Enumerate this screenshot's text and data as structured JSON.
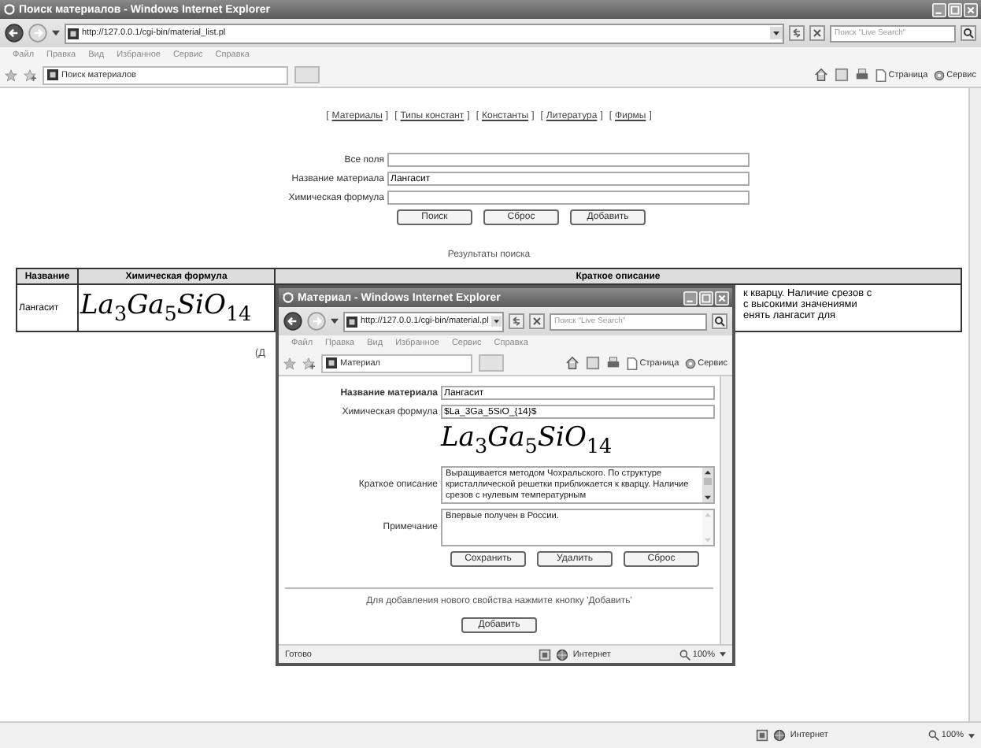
{
  "window": {
    "title": "Поиск материалов - Windows Internet Explorer",
    "url": "http://127.0.0.1/cgi-bin/material_list.pl",
    "search_placeholder": "Поиск \"Live Search\"",
    "menu": [
      "Файл",
      "Правка",
      "Вид",
      "Избранное",
      "Сервис",
      "Справка"
    ],
    "tabs": [
      {
        "label": "Поиск материалов",
        "selected": true
      }
    ],
    "command_bar": {
      "page": "Страница",
      "tools": "Сервис"
    },
    "status_bar": {
      "zone": "Интернет",
      "zoom": "100%"
    }
  },
  "nav_links": [
    {
      "open": "[",
      "label": "Материалы",
      "close": "]"
    },
    {
      "open": "[",
      "label": "Типы констант",
      "close": "]"
    },
    {
      "open": "[",
      "label": "Константы",
      "close": "]"
    },
    {
      "open": "[",
      "label": "Литература",
      "close": "]"
    },
    {
      "open": "[",
      "label": "Фирмы",
      "close": "]"
    }
  ],
  "search_form": {
    "fields": [
      {
        "label": "Все поля"
      },
      {
        "label": "Название материала",
        "value": "Лангасит"
      },
      {
        "label": "Химическая формула"
      }
    ],
    "buttons": [
      "Поиск",
      "Сброс",
      "Добавить"
    ]
  },
  "results_title": "Результаты поиска",
  "table": {
    "columns": [
      "Название",
      "Химическая формула",
      "Краткое описание"
    ],
    "rows": [
      {
        "name": "Лангасит",
        "formula": "La$_{3}$Ga$_{5}$SiO$_{14}$",
        "description": [
          "к кварцу. Наличие срезов с",
          "с высокими значениями",
          "енять лангасит для"
        ]
      }
    ]
  },
  "below_table": "(Д",
  "popup_window": {
    "title": "Материал - Windows Internet Explorer",
    "url": "http://127.0.0.1/cgi-bin/material.pl",
    "search_placeholder": "Поиск \"Live Search\"",
    "menu": [
      "Файл",
      "Правка",
      "Вид",
      "Избранное",
      "Сервис",
      "Справка"
    ],
    "tabs": [
      {
        "label": "Материал",
        "selected": true
      }
    ],
    "command_bar": {
      "page": "Страница",
      "tools": "Сервис"
    },
    "fields": [
      {
        "kind": "input",
        "label": "Название материала",
        "bold": true,
        "value": "Лангасит"
      },
      {
        "kind": "input",
        "label": "Химическая формула",
        "bold": false,
        "value": "$La_3Ga_5SiO_{14}$"
      },
      {
        "kind": "formula",
        "value": "La$_{3}$Ga$_{5}$SiO$_{14}$"
      },
      {
        "kind": "textarea",
        "label": "Краткое описание",
        "bold": false,
        "value": "Выращивается методом Чохральского. По структуре кристаллической решетки приближается к кварцу. Наличие срезов с нулевым температурным",
        "scrollable": true
      },
      {
        "kind": "textarea",
        "label": "Примечание",
        "bold": false,
        "value": "Впервые получен в России.",
        "scrollable": false
      }
    ],
    "buttons": [
      "Сохранить",
      "Удалить",
      "Сброс"
    ],
    "hint": "Для добавления нового свойства нажмите кнопку 'Добавить'",
    "add_button": "Добавить",
    "status_bar": {
      "text": "Готово",
      "zone": "Интернет",
      "zoom": "100%"
    }
  }
}
